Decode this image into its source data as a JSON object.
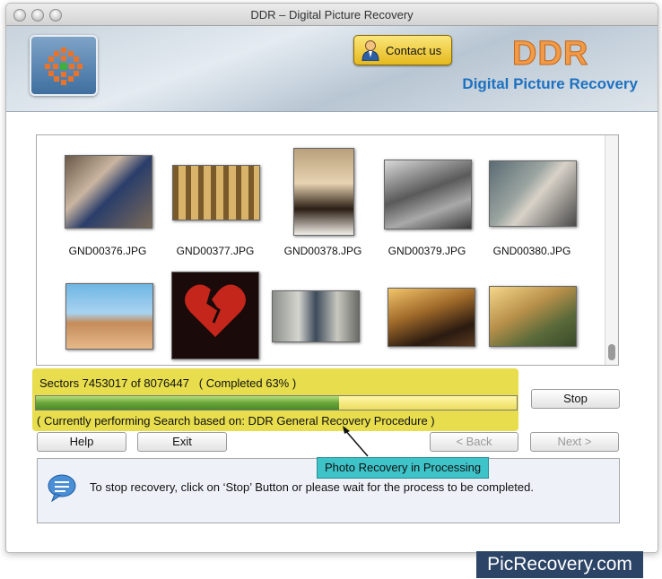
{
  "window": {
    "title": "DDR – Digital Picture Recovery"
  },
  "header": {
    "contact_label": "Contact us",
    "brand": "DDR",
    "subtitle": "Digital Picture Recovery"
  },
  "thumbnails": [
    {
      "name": "GND00376.JPG"
    },
    {
      "name": "GND00377.JPG"
    },
    {
      "name": "GND00378.JPG"
    },
    {
      "name": "GND00379.JPG"
    },
    {
      "name": "GND00380.JPG"
    }
  ],
  "progress": {
    "sectors_text": "Sectors 7453017 of 8076447   ( Completed 63% )",
    "percent": 63,
    "status_text": "( Currently performing Search based on: DDR General Recovery Procedure )"
  },
  "buttons": {
    "stop": "Stop",
    "help": "Help",
    "exit": "Exit",
    "back": "< Back",
    "next": "Next >"
  },
  "callout": "Photo Recovery in Processing",
  "info": "To stop recovery, click on ‘Stop’ Button or please wait for the process to be completed.",
  "watermark": "PicRecovery.com",
  "colors": {
    "highlight": "#e7dd4d",
    "progress_fill": "#6aa63a",
    "brand": "#f19a48",
    "subtitle": "#1e71c0",
    "callout": "#3ec3c9"
  }
}
